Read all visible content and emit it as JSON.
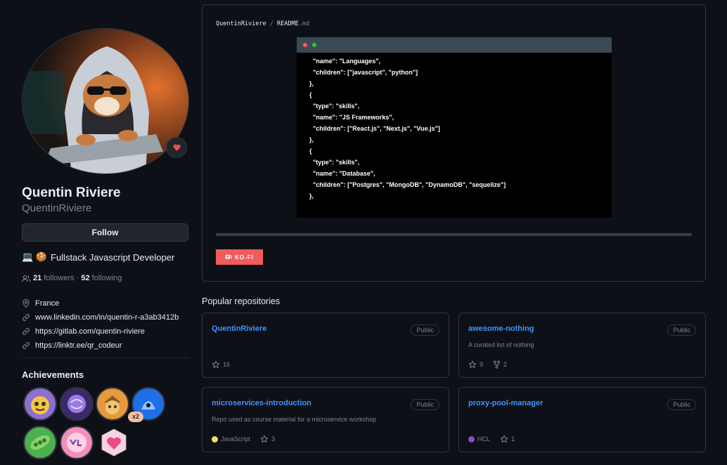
{
  "profile": {
    "name": "Quentin Riviere",
    "login": "QuentinRiviere",
    "follow_label": "Follow",
    "bio": "Fullstack Javascript Developer",
    "bio_emojis": "💻 🍪",
    "followers_count": "21",
    "followers_label": "followers",
    "following_count": "52",
    "following_label": "following",
    "separator": "·",
    "location": "France",
    "links": [
      "www.linkedin.com/in/quentin-r-a3ab3412b",
      "https://gitlab.com/quentin-riviere",
      "https://linktr.ee/qr_codeur"
    ]
  },
  "achievements": {
    "title": "Achievements",
    "badges": [
      "starstruck",
      "galaxy-brain",
      "pull-shark",
      "quickdraw",
      "pair-extraordinaire",
      "yolo",
      "public-sponsor"
    ],
    "quickdraw_count": "x2"
  },
  "readme": {
    "owner": "QuentinRiviere",
    "separator": "/",
    "file": "README",
    "ext": ".md",
    "code": "  \"name\": \"Languages\",\n  \"children\": [\"javascript\", \"python\"]\n},\n{\n  \"type\": \"skills\",\n  \"name\": \"JS Frameworks\",\n  \"children\": [\"React.js\", \"Next.js\", \"Vue.js\"]\n},\n{\n  \"type\": \"skills\",\n  \"name\": \"Database\",\n  \"children\": [\"Postgres\", \"MongoDB\", \"DynamoDB\", \"sequelize\"]\n},",
    "kofi_label": "KO-FI"
  },
  "repositories": {
    "title": "Popular repositories",
    "items": [
      {
        "name": "QuentinRiviere",
        "visibility": "Public",
        "description": "",
        "language": "",
        "stars": "16",
        "forks": ""
      },
      {
        "name": "awesome-nothing",
        "visibility": "Public",
        "description": "A curated list of nothing",
        "language": "",
        "stars": "9",
        "forks": "2"
      },
      {
        "name": "microservices-introduction",
        "visibility": "Public",
        "description": "Repo used as course material for a microservice workshop",
        "language": "JavaScript",
        "stars": "3",
        "forks": ""
      },
      {
        "name": "proxy-pool-manager",
        "visibility": "Public",
        "description": "",
        "language": "HCL",
        "stars": "1",
        "forks": ""
      }
    ]
  },
  "colors": {
    "background": "#0d1117",
    "link": "#4493f8",
    "muted": "#7d8590",
    "javascript": "#f1e05a",
    "hcl": "#844fba",
    "kofi": "#f05b5b"
  },
  "icons": [
    "heart-icon",
    "people-icon",
    "location-icon",
    "link-icon",
    "star-icon",
    "fork-icon",
    "coffee-cup-icon"
  ]
}
